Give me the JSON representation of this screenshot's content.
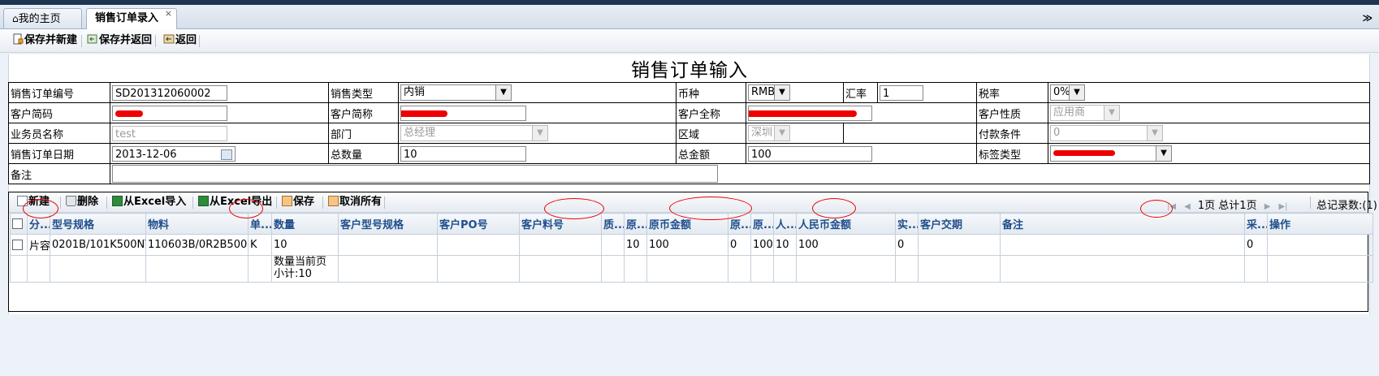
{
  "tabs": [
    {
      "label": "我的主页",
      "active": false
    },
    {
      "label": "销售订单录入",
      "active": true,
      "close": "×"
    }
  ],
  "tabbar_arrow": "≫",
  "toolbar": {
    "save_new": "保存并新建",
    "save_return": "保存并返回",
    "back": "返回"
  },
  "form": {
    "title": "销售订单输入",
    "order_no_label": "销售订单编号",
    "order_no": "SD201312060002",
    "sales_type_label": "销售类型",
    "sales_type": "内销",
    "currency_label": "币种",
    "currency": "RMB",
    "rate_label": "汇率",
    "rate": "1",
    "tax_label": "税率",
    "tax": "0%",
    "cust_code_label": "客户简码",
    "cust_short_label": "客户简称",
    "cust_full_label": "客户全称",
    "cust_nature_label": "客户性质",
    "cust_nature": "应用商",
    "salesman_label": "业务员名称",
    "salesman": "test",
    "dept_label": "部门",
    "dept": "总经理",
    "region_label": "区域",
    "region": "深圳",
    "payment_label": "付款条件",
    "payment": "0",
    "date_label": "销售订单日期",
    "date": "2013-12-06",
    "total_qty_label": "总数量",
    "total_qty": "10",
    "total_amt_label": "总金额",
    "total_amt": "100",
    "label_type_label": "标签类型",
    "remark_label": "备注",
    "remark": ""
  },
  "grid_toolbar": {
    "add": "新建",
    "delete": "删除",
    "import": "从Excel导入",
    "export": "从Excel导出",
    "save": "保存",
    "cancel_all": "取消所有",
    "page_info": "1页 总计1页",
    "total_records": "总记录数:(1)"
  },
  "grid": {
    "columns": [
      "分...",
      "型号规格",
      "物料",
      "单...",
      "数量",
      "客户型号规格",
      "客户PO号",
      "客户料号",
      "质...",
      "原...",
      "原币金额",
      "原...",
      "原...",
      "人...",
      "人民币金额",
      "实...",
      "客户交期",
      "备注",
      "采...",
      "操作"
    ],
    "rows": [
      [
        "片容",
        "0201B/101K500NT",
        "110603B/0R2B500NB",
        "K",
        "10",
        "",
        "",
        "",
        "",
        "10",
        "100",
        "0",
        "100",
        "10",
        "100",
        "0",
        "",
        "",
        "0",
        ""
      ]
    ],
    "summary": "数量当前页小计:10"
  },
  "colors": {
    "accent": "#1f4e8c",
    "highlight_oval": "#e00000",
    "topline": "#1e3552"
  }
}
